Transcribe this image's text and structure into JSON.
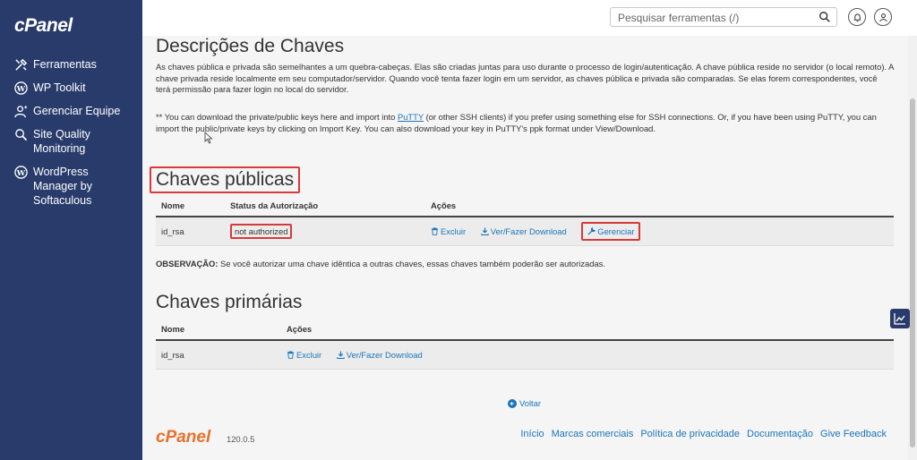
{
  "sidebar": {
    "logo": "cPanel",
    "items": [
      {
        "label": "Ferramentas",
        "icon": "tools-icon"
      },
      {
        "label": "WP Toolkit",
        "icon": "wordpress-icon"
      },
      {
        "label": "Gerenciar Equipe",
        "icon": "user-group-icon"
      },
      {
        "label": "Site Quality Monitoring",
        "icon": "search-monitor-icon"
      },
      {
        "label": "WordPress Manager by Softaculous",
        "icon": "wordpress-icon"
      }
    ]
  },
  "topbar": {
    "search_placeholder": "Pesquisar ferramentas (/)"
  },
  "main": {
    "title": "Descrições de Chaves",
    "intro": "As chaves pública e privada são semelhantes a um quebra-cabeças. Elas são criadas juntas para uso durante o processo de login/autenticação. A chave pública reside no servidor (o local remoto). A chave privada reside localmente em seu computador/servidor. Quando você tenta fazer login em um servidor, as chaves pública e privada são comparadas. Se elas forem correspondentes, você terá permissão para fazer login no local do servidor.",
    "note_pre": "** You can download the private/public keys here and import into ",
    "note_link": "PuTTY",
    "note_post": " (or other SSH clients) if you prefer using something else for SSH connections. Or, if you have been using PuTTY, you can import the public/private keys by clicking on Import Key. You can also download your key in PuTTY's ppk format under View/Download.",
    "public_keys": {
      "heading": "Chaves públicas",
      "headers": {
        "name": "Nome",
        "status": "Status da Autorização",
        "actions": "Ações"
      },
      "rows": [
        {
          "name": "id_rsa",
          "status": "not authorized",
          "delete": "Excluir",
          "view": "Ver/Fazer Download",
          "manage": "Gerenciar"
        }
      ]
    },
    "observation_label": "OBSERVAÇÃO:",
    "observation_text": " Se você autorizar uma chave idêntica a outras chaves, essas chaves também poderão ser autorizadas.",
    "private_keys": {
      "heading": "Chaves primárias",
      "headers": {
        "name": "Nome",
        "actions": "Ações"
      },
      "rows": [
        {
          "name": "id_rsa",
          "delete": "Excluir",
          "view": "Ver/Fazer Download"
        }
      ]
    },
    "back": "Voltar"
  },
  "footer": {
    "logo": "cPanel",
    "version": "120.0.5",
    "links": [
      "Início",
      "Marcas comerciais",
      "Política de privacidade",
      "Documentação",
      "Give Feedback"
    ]
  },
  "colors": {
    "sidebar_bg": "#283b6b",
    "link": "#1b75bb",
    "highlight": "#d9393b",
    "brand_orange": "#e8702a"
  }
}
